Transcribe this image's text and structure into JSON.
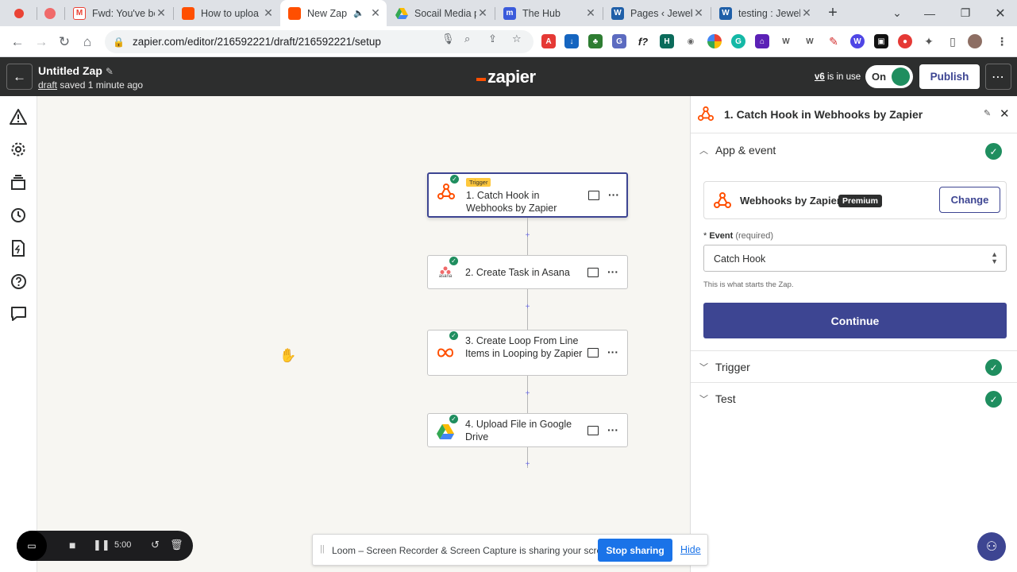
{
  "browser": {
    "tabs": [
      {
        "title": "",
        "fav_color": "#ea4335",
        "fav_glyph": "●"
      },
      {
        "title": "",
        "fav_color": "#f06a6a",
        "fav_glyph": "⁂"
      },
      {
        "title": "Fwd: You've be",
        "fav_color": "#ea4335",
        "fav_glyph": "M"
      },
      {
        "title": "How to uploa",
        "fav_color": "#ff4f00",
        "fav_glyph": "z"
      },
      {
        "title": "New Zap",
        "fav_color": "#ff4f00",
        "fav_glyph": "z",
        "active": true
      },
      {
        "title": "Socail Media p",
        "fav_color": "#fbbc04",
        "fav_glyph": "▲"
      },
      {
        "title": "The Hub",
        "fav_color": "#3b5bdb",
        "fav_glyph": "m"
      },
      {
        "title": "Pages ‹ Jewell",
        "fav_color": "#1f5fa8",
        "fav_glyph": "W"
      },
      {
        "title": "testing : Jewell",
        "fav_color": "#1f5fa8",
        "fav_glyph": "W"
      }
    ],
    "new_tab": "+",
    "url": "zapier.com/editor/216592221/draft/216592221/setup"
  },
  "header": {
    "zap_title": "Untitled Zap",
    "status_draft": "draft",
    "status_saved": "saved 1 minute ago",
    "logo": "zapier",
    "version": "v6",
    "version_suffix": "is in use",
    "toggle_label": "On",
    "publish_label": "Publish"
  },
  "steps": [
    {
      "label": "1. Catch Hook in Webhooks by Zapier",
      "badge": "Trigger",
      "icon": "webhook-icon"
    },
    {
      "label": "2. Create Task in Asana",
      "icon": "asana-icon",
      "icon_text": "asana"
    },
    {
      "label": "3. Create Loop From Line Items in Looping by Zapier",
      "icon": "looping-icon"
    },
    {
      "label": "4. Upload File in Google Drive",
      "icon": "google-drive-icon"
    }
  ],
  "panel": {
    "title": "1. Catch Hook in Webhooks by Zapier",
    "sections": {
      "app_event": "App & event",
      "trigger": "Trigger",
      "test": "Test"
    },
    "app_name": "Webhooks by Zapier",
    "premium": "Premium",
    "change": "Change",
    "event_label": "Event",
    "event_required": "(required)",
    "event_value": "Catch Hook",
    "event_hint": "This is what starts the Zap.",
    "continue": "Continue"
  },
  "loom": {
    "time": "5:00",
    "share_msg": "Loom – Screen Recorder & Screen Capture is sharing your screen.",
    "stop": "Stop sharing",
    "hide": "Hide"
  },
  "colors": {
    "zapier_orange": "#ff4f00",
    "brand_purple": "#3d4592",
    "success_green": "#1f8e5f",
    "header_dark": "#2d2e2e"
  }
}
